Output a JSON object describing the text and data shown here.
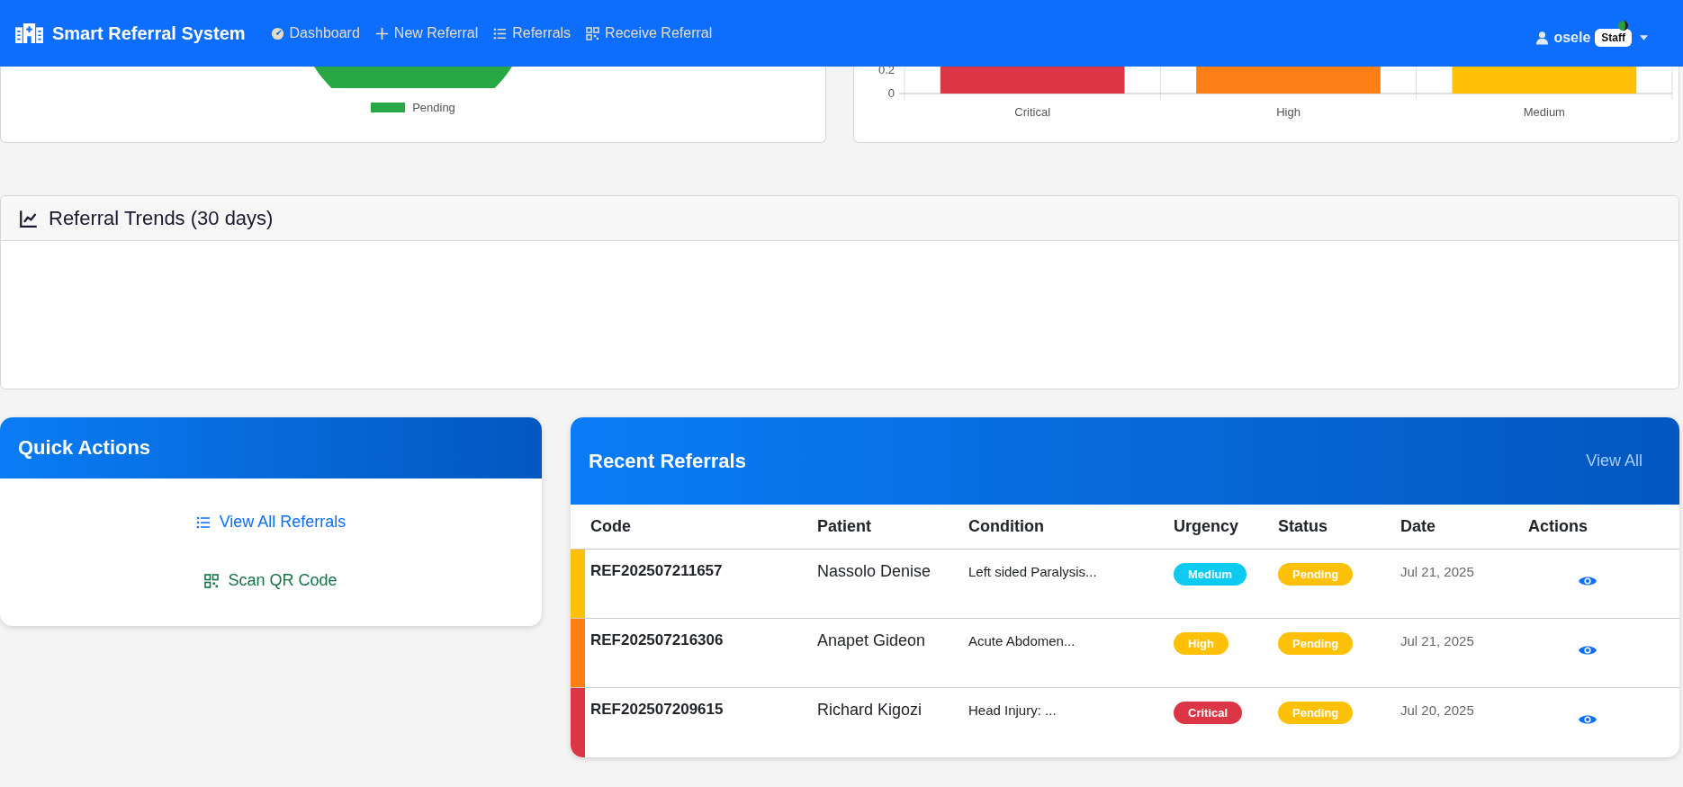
{
  "navbar": {
    "brand": "Smart Referral System",
    "links": [
      {
        "label": "Dashboard",
        "kind": "gauge"
      },
      {
        "label": "New Referral",
        "kind": "plus"
      },
      {
        "label": "Referrals",
        "kind": "list"
      },
      {
        "label": "Receive Referral",
        "kind": "qr"
      }
    ],
    "user": {
      "name": "osele",
      "role": "Staff"
    }
  },
  "status_chart": {
    "legend": [
      {
        "label": "Pending",
        "color": "#28a745"
      }
    ]
  },
  "urgency_chart": {
    "y_labels": [
      "0.2",
      "0"
    ],
    "bars": [
      {
        "label": "Critical",
        "color": "#dc3545"
      },
      {
        "label": "High",
        "color": "#fd7e14"
      },
      {
        "label": "Medium",
        "color": "#ffc107"
      }
    ]
  },
  "trends": {
    "title": "Referral Trends (30 days)"
  },
  "quick_actions": {
    "title": "Quick Actions",
    "actions": [
      {
        "label": "View All Referrals",
        "kind": "list"
      },
      {
        "label": "Scan QR Code",
        "kind": "qr"
      }
    ]
  },
  "recent": {
    "title": "Recent Referrals",
    "view_all": "View All",
    "columns": [
      "Code",
      "Patient",
      "Condition",
      "Urgency",
      "Status",
      "Date",
      "Actions"
    ],
    "rows": [
      {
        "color": "#ffc107",
        "code": "REF202507211657",
        "patient": "Nassolo Denise",
        "condition": "Left sided Paralysis...",
        "urgency": {
          "label": "Medium",
          "color": "#0dcaf0"
        },
        "status": {
          "label": "Pending",
          "color": "#ffc107"
        },
        "date": "Jul 21, 2025"
      },
      {
        "color": "#fd7e14",
        "code": "REF202507216306",
        "patient": "Anapet Gideon",
        "condition": "Acute Abdomen...",
        "urgency": {
          "label": "High",
          "color": "#ffc107"
        },
        "status": {
          "label": "Pending",
          "color": "#ffc107"
        },
        "date": "Jul 21, 2025"
      },
      {
        "color": "#dc3545",
        "code": "REF202507209615",
        "patient": "Richard Kigozi",
        "condition": "Head Injury: ...",
        "urgency": {
          "label": "Critical",
          "color": "#dc3545"
        },
        "status": {
          "label": "Pending",
          "color": "#ffc107"
        },
        "date": "Jul 20, 2025"
      }
    ]
  }
}
